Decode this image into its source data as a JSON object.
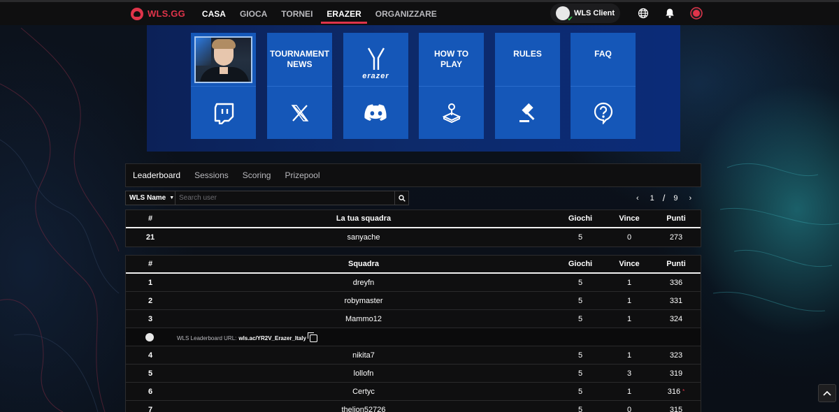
{
  "brand": {
    "name": "WLS.GG",
    "accent": "#e0344a"
  },
  "nav": {
    "items": [
      {
        "label": "CASA"
      },
      {
        "label": "GIOCA"
      },
      {
        "label": "TORNEI"
      },
      {
        "label": "ERAZER"
      },
      {
        "label": "ORGANIZZARE"
      }
    ],
    "active": "ERAZER"
  },
  "client": {
    "label": "WLS Client"
  },
  "banner": {
    "tiles": [
      {
        "title": "",
        "bottom_icon": "twitch-icon"
      },
      {
        "title": "TOURNAMENT NEWS",
        "bottom_icon": "x-icon"
      },
      {
        "title": "erazer",
        "bottom_icon": "discord-icon"
      },
      {
        "title": "HOW TO PLAY",
        "bottom_icon": "joystick-icon"
      },
      {
        "title": "RULES",
        "bottom_icon": "gavel-icon"
      },
      {
        "title": "FAQ",
        "bottom_icon": "question-icon"
      }
    ]
  },
  "tabs": [
    {
      "label": "Leaderboard"
    },
    {
      "label": "Sessions"
    },
    {
      "label": "Scoring"
    },
    {
      "label": "Prizepool"
    }
  ],
  "search": {
    "filter_label": "WLS Name",
    "placeholder": "Search user"
  },
  "pager": {
    "current": "1",
    "separator": "/",
    "total": "9"
  },
  "my_team": {
    "headers": {
      "rank": "#",
      "team": "La tua squadra",
      "games": "Giochi",
      "wins": "Vince",
      "points": "Punti"
    },
    "row": {
      "rank": "21",
      "name": "sanyache",
      "games": "5",
      "wins": "0",
      "points": "273"
    }
  },
  "leaderboard": {
    "headers": {
      "rank": "#",
      "team": "Squadra",
      "games": "Giochi",
      "wins": "Vince",
      "points": "Punti"
    },
    "rows_top": [
      {
        "rank": "1",
        "name": "dreyfn",
        "games": "5",
        "wins": "1",
        "points": "336"
      },
      {
        "rank": "2",
        "name": "robymaster",
        "games": "5",
        "wins": "1",
        "points": "331"
      },
      {
        "rank": "3",
        "name": "Mammo12",
        "games": "5",
        "wins": "1",
        "points": "324"
      }
    ],
    "url_label": "WLS Leaderboard URL:",
    "url": "wls.ac/YR2V_Erazer_Italy",
    "rows_rest": [
      {
        "rank": "4",
        "name": "nikita7",
        "games": "5",
        "wins": "1",
        "points": "323"
      },
      {
        "rank": "5",
        "name": "lollofn",
        "games": "5",
        "wins": "3",
        "points": "319"
      },
      {
        "rank": "6",
        "name": "Certyc",
        "games": "5",
        "wins": "1",
        "points": "316"
      },
      {
        "rank": "7",
        "name": "thelion52726",
        "games": "5",
        "wins": "0",
        "points": "315"
      }
    ]
  }
}
